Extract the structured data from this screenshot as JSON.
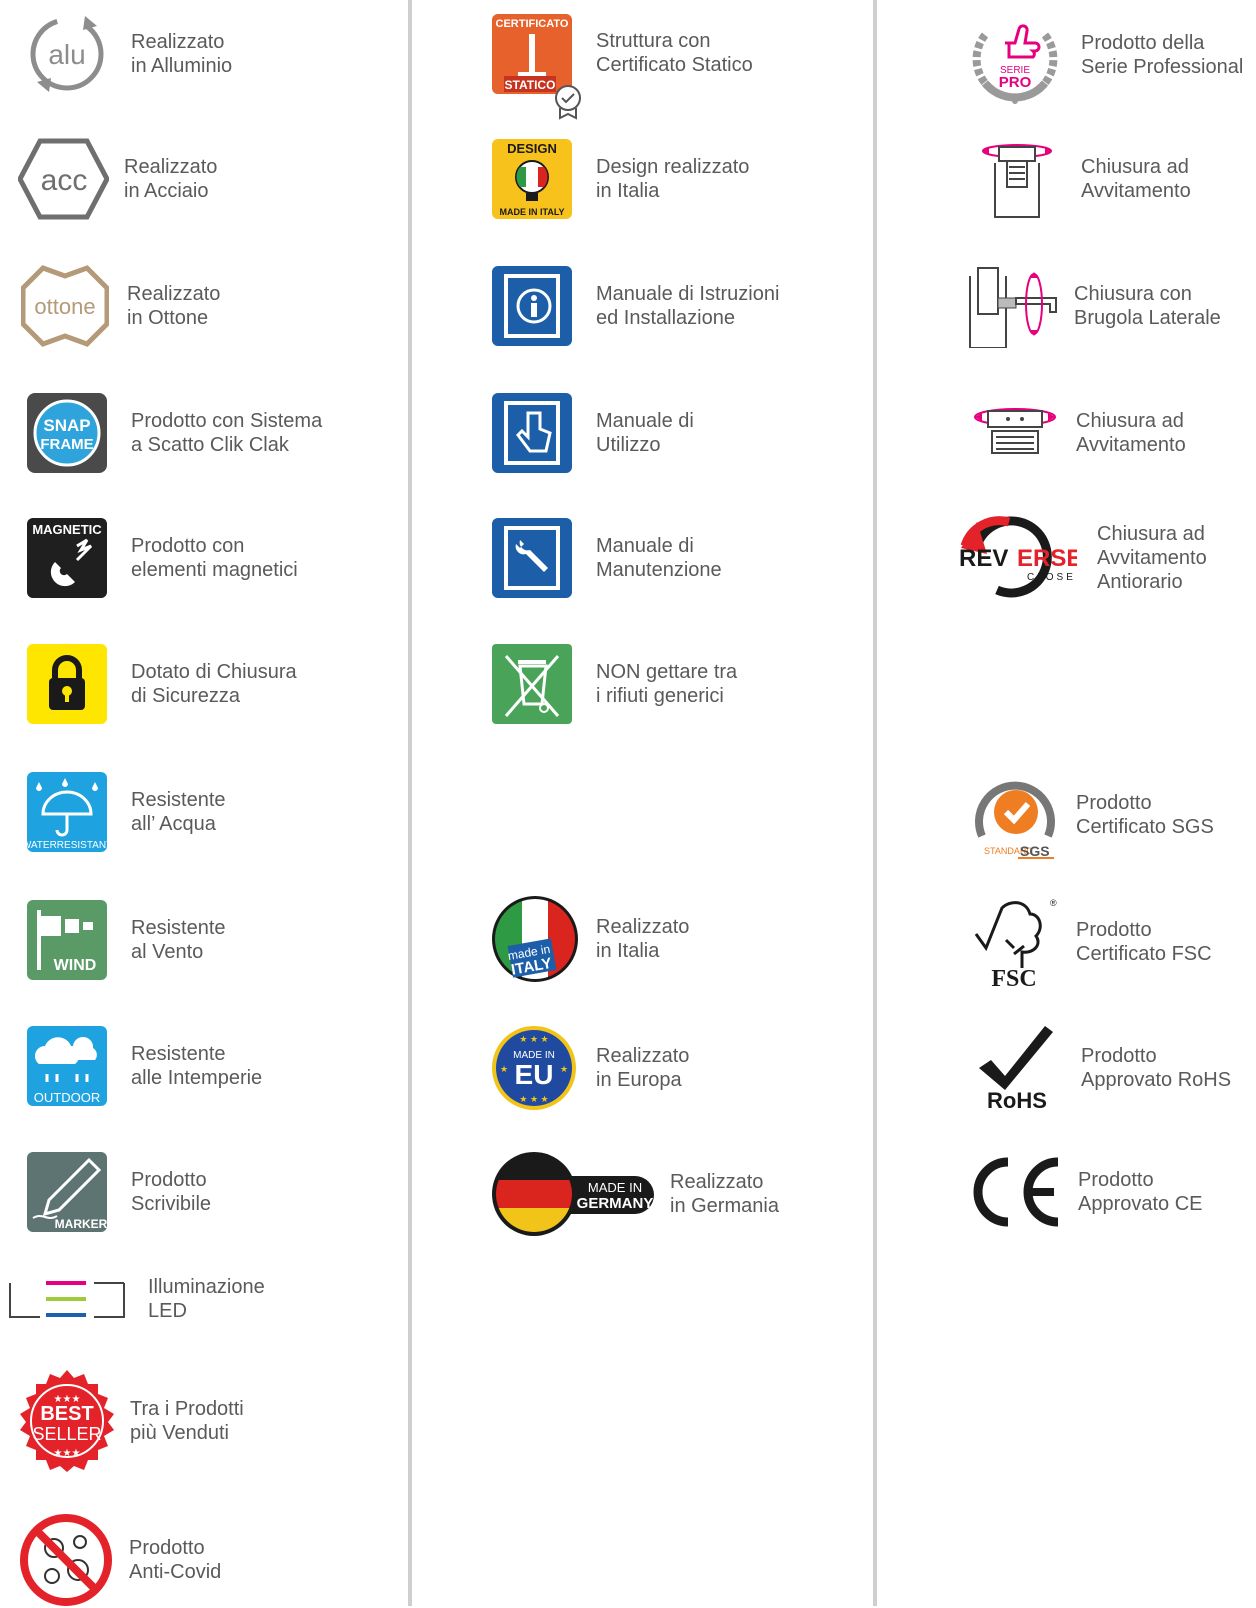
{
  "col1": [
    {
      "l1": "Realizzato",
      "l2": "in Alluminio",
      "icon": "alu-icon",
      "text": "alu"
    },
    {
      "l1": "Realizzato",
      "l2": "in Acciaio",
      "icon": "acc-icon",
      "text": "acc"
    },
    {
      "l1": "Realizzato",
      "l2": "in Ottone",
      "icon": "ottone-icon",
      "text": "ottone"
    },
    {
      "l1": "Prodotto con Sistema",
      "l2": "a Scatto Clik Clak",
      "icon": "snap-frame-icon",
      "text": "SNAP FRAME"
    },
    {
      "l1": "Prodotto con",
      "l2": "elementi magnetici",
      "icon": "magnetic-icon",
      "text": "MAGNETIC"
    },
    {
      "l1": "Dotato di Chiusura",
      "l2": "di Sicurezza",
      "icon": "padlock-icon"
    },
    {
      "l1": "Resistente",
      "l2": "all’ Acqua",
      "icon": "water-resistant-icon",
      "text": "WATERRESISTANT"
    },
    {
      "l1": "Resistente",
      "l2": "al Vento",
      "icon": "wind-icon",
      "text": "WIND"
    },
    {
      "l1": "Resistente",
      "l2": "alle Intemperie",
      "icon": "outdoor-icon",
      "text": "OUTDOOR"
    },
    {
      "l1": "Prodotto",
      "l2": "Scrivibile",
      "icon": "marker-icon",
      "text": "MARKER"
    },
    {
      "l1": "Illuminazione",
      "l2": "LED",
      "icon": "led-icon",
      "text": "LED"
    },
    {
      "l1": "Tra i Prodotti",
      "l2": "più Venduti",
      "icon": "best-seller-icon",
      "text": "BEST SELLER"
    },
    {
      "l1": "Prodotto",
      "l2": "Anti-Covid",
      "icon": "anti-covid-icon"
    }
  ],
  "col2": [
    {
      "l1": "Struttura con",
      "l2": "Certificato Statico",
      "icon": "certificato-statico-icon",
      "text": "CERTIFICATO STATICO"
    },
    {
      "l1": "Design realizzato",
      "l2": "in Italia",
      "icon": "design-made-in-italy-icon",
      "text": "DESIGN MADE IN ITALY"
    },
    {
      "l1": "Manuale di Istruzioni",
      "l2": "ed Installazione",
      "icon": "manual-info-icon"
    },
    {
      "l1": "Manuale di",
      "l2": "Utilizzo",
      "icon": "manual-hand-icon"
    },
    {
      "l1": "Manuale di",
      "l2": "Manutenzione",
      "icon": "manual-wrench-icon"
    },
    {
      "l1": "NON gettare tra",
      "l2": "i rifiuti generici",
      "icon": "weee-bin-icon"
    },
    {
      "l1": "Realizzato",
      "l2": "in Italia",
      "icon": "made-in-italy-icon",
      "text": "made in ITALY"
    },
    {
      "l1": "Realizzato",
      "l2": "in Europa",
      "icon": "made-in-eu-icon",
      "text": "MADE IN EU"
    },
    {
      "l1": "Realizzato",
      "l2": "in Germania",
      "icon": "made-in-germany-icon",
      "text": "MADE IN GERMANY"
    }
  ],
  "col3": [
    {
      "l1": "Prodotto della",
      "l2": "Serie Professional",
      "icon": "serie-pro-icon",
      "text": "SERIE PRO"
    },
    {
      "l1": "Chiusura ad",
      "l2": "Avvitamento",
      "icon": "screw-closure-icon"
    },
    {
      "l1": "Chiusura con",
      "l2": "Brugola Laterale",
      "icon": "allen-side-closure-icon"
    },
    {
      "l1": "Chiusura ad",
      "l2": "Avvitamento",
      "icon": "screw-closure-flat-icon"
    },
    {
      "l1": "Chiusura ad",
      "l2": "Avvitamento",
      "l3": "Antiorario",
      "icon": "reverse-close-icon",
      "text": "REVERSE CLOSE"
    },
    {
      "l1": "Prodotto",
      "l2": "Certificato SGS",
      "icon": "sgs-icon",
      "text": "STANDARD SGS"
    },
    {
      "l1": "Prodotto",
      "l2": "Certificato FSC",
      "icon": "fsc-icon",
      "text": "FSC"
    },
    {
      "l1": "Prodotto",
      "l2": "Approvato RoHS",
      "icon": "rohs-icon",
      "text": "RoHS"
    },
    {
      "l1": "Prodotto",
      "l2": "Approvato CE",
      "icon": "ce-icon",
      "text": "CE"
    }
  ]
}
